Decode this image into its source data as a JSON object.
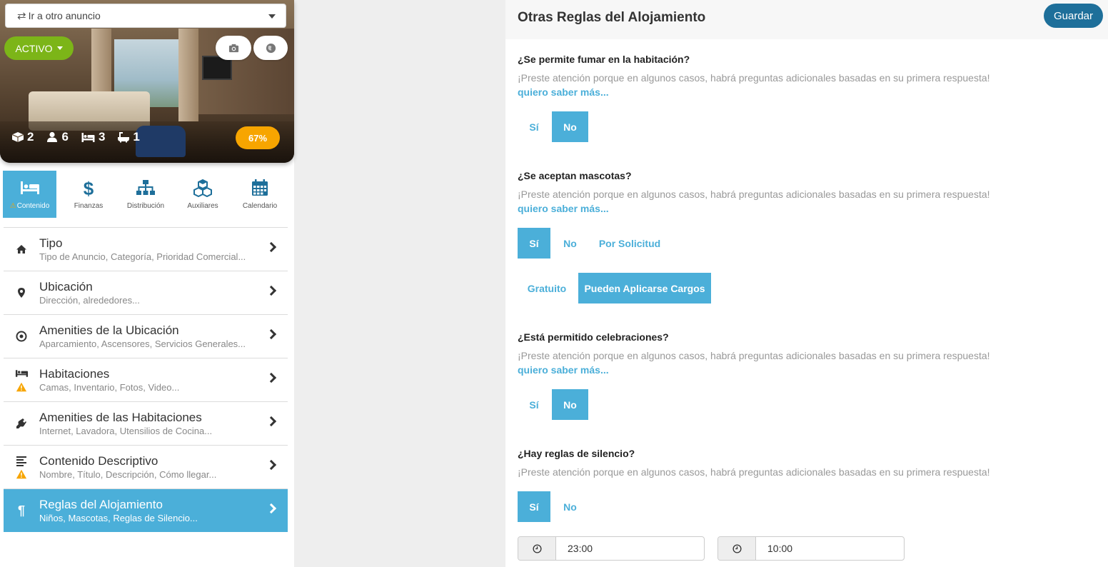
{
  "listing": {
    "goto_label": "Ir a otro anuncio",
    "status_label": "ACTIVO",
    "stats": {
      "bedrooms": "2",
      "guests": "6",
      "beds": "3",
      "baths": "1"
    },
    "completion": "67%"
  },
  "tabs": [
    {
      "label": "Contenido",
      "icon": "bed-icon",
      "active": true,
      "warning": true
    },
    {
      "label": "Finanzas",
      "icon": "dollar-icon"
    },
    {
      "label": "Distribución",
      "icon": "sitemap-icon"
    },
    {
      "label": "Auxiliares",
      "icon": "cubes-icon"
    },
    {
      "label": "Calendario",
      "icon": "calendar-icon"
    }
  ],
  "menu": [
    {
      "title": "Tipo",
      "subtitle": "Tipo de Anuncio, Categoría, Prioridad Comercial...",
      "icon": "home-icon"
    },
    {
      "title": "Ubicación",
      "subtitle": "Dirección, alrededores...",
      "icon": "map-pin-icon"
    },
    {
      "title": "Amenities de la Ubicación",
      "subtitle": "Aparcamiento, Ascensores, Servicios Generales...",
      "icon": "target-icon"
    },
    {
      "title": "Habitaciones",
      "subtitle": "Camas, Inventario, Fotos, Video...",
      "icon": "bed-icon",
      "warning": true
    },
    {
      "title": "Amenities de las Habitaciones",
      "subtitle": "Internet, Lavadora, Utensilios de Cocina...",
      "icon": "plug-icon"
    },
    {
      "title": "Contenido Descriptivo",
      "subtitle": "Nombre, Título, Descripción, Cómo llegar...",
      "icon": "align-left-icon",
      "warning": true
    },
    {
      "title": "Reglas del Alojamiento",
      "subtitle": "Niños, Mascotas, Reglas de Silencio...",
      "icon": "paragraph-icon",
      "active": true
    }
  ],
  "panel": {
    "title": "Otras Reglas del Alojamiento",
    "save_label": "Guardar",
    "hint": "¡Preste atención porque en algunos casos, habrá preguntas adicionales basadas en su primera respuesta!",
    "more_link": "quiero saber más...",
    "questions": [
      {
        "label": "¿Se permite fumar en la habitación?",
        "options": [
          "Sí",
          "No"
        ],
        "selected": "No"
      },
      {
        "label": "¿Se aceptan mascotas?",
        "options": [
          "Sí",
          "No",
          "Por Solicitud"
        ],
        "selected": "Sí",
        "sub_options": [
          "Gratuito",
          "Pueden Aplicarse Cargos"
        ],
        "sub_selected": "Pueden Aplicarse Cargos"
      },
      {
        "label": "¿Está permitido celebraciones?",
        "options": [
          "Sí",
          "No"
        ],
        "selected": "No"
      },
      {
        "label": "¿Hay reglas de silencio?",
        "options": [
          "Sí",
          "No"
        ],
        "selected": "Sí",
        "quiet_start": "23:00",
        "quiet_end": "10:00"
      }
    ]
  },
  "colors": {
    "accent": "#4bafd9",
    "save": "#1e6f9a",
    "active_status": "#7cb518",
    "completion": "#f7a500",
    "warning": "#f7a500"
  }
}
